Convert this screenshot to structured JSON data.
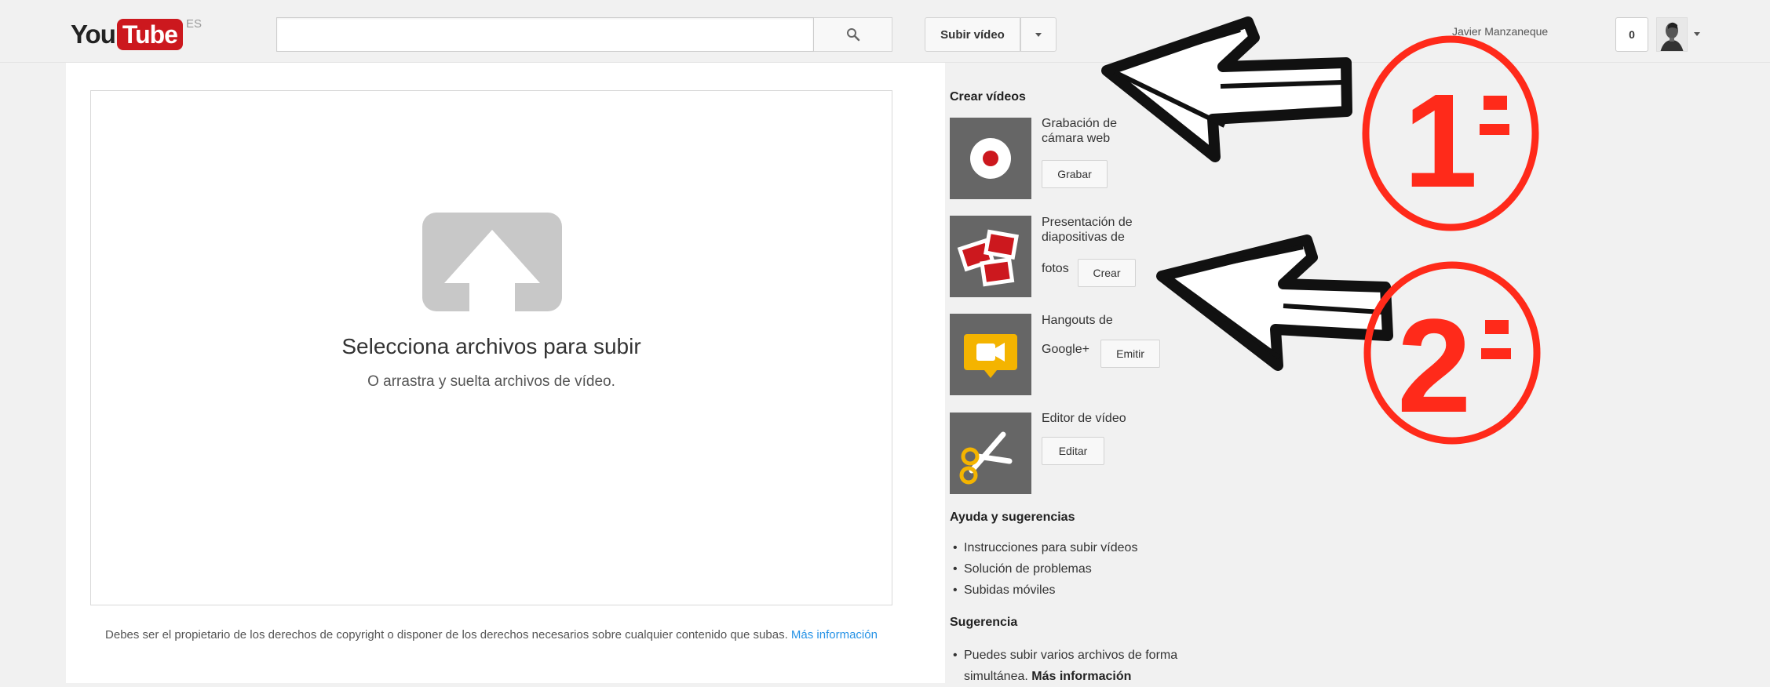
{
  "header": {
    "logo_you": "You",
    "logo_tube": "Tube",
    "logo_region": "ES",
    "search_placeholder": "",
    "upload_label": "Subir vídeo",
    "user_name": "Javier Manzaneque",
    "notification_count": "0"
  },
  "upload": {
    "title": "Selecciona archivos para subir",
    "subtitle": "O arrastra y suelta archivos de vídeo.",
    "copyright_text": "Debes ser el propietario de los derechos de copyright o disponer de los derechos necesarios sobre cualquier contenido que subas.",
    "copyright_link": "Más información"
  },
  "sidebar": {
    "create_title": "Crear vídeos",
    "items": [
      {
        "line1": "Grabación de",
        "line2": "cámara web",
        "button": "Grabar",
        "icon": "webcam-record-icon"
      },
      {
        "line1": "Presentación de",
        "line2": "diapositivas de",
        "line3": "fotos",
        "button": "Crear",
        "icon": "photo-slideshow-icon"
      },
      {
        "line1": "Hangouts de",
        "line2": "Google+",
        "button": "Emitir",
        "icon": "hangouts-camera-icon"
      },
      {
        "line1": "Editor de vídeo",
        "button": "Editar",
        "icon": "scissors-icon"
      }
    ],
    "help_title": "Ayuda y sugerencias",
    "help_links": [
      "Instrucciones para subir vídeos",
      "Solución de problemas",
      "Subidas móviles"
    ],
    "tip_title": "Sugerencia",
    "tip_text_1": "Puedes subir varios archivos de forma",
    "tip_text_2": "simultánea.",
    "tip_link": "Más información"
  },
  "annotations": {
    "label_1": "1",
    "label_2": "2",
    "color": "#ff2a1a"
  },
  "colors": {
    "brand_red": "#cc181e",
    "link_blue": "#2793e6",
    "background": "#f1f1f1"
  }
}
